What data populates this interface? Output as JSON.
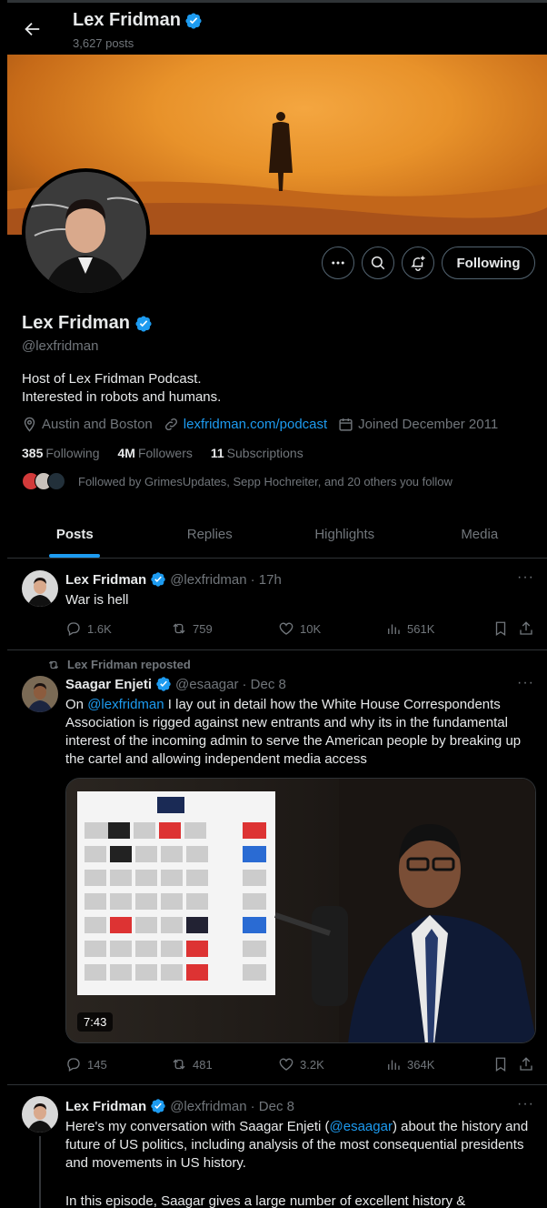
{
  "header": {
    "name": "Lex Fridman",
    "posts_count": "3,627 posts"
  },
  "profile": {
    "name": "Lex Fridman",
    "handle": "@lexfridman",
    "bio_line1": "Host of Lex Fridman Podcast.",
    "bio_line2": "Interested in robots and humans.",
    "location": "Austin and Boston",
    "website": "lexfridman.com/podcast",
    "joined": "Joined December 2011",
    "following_count": "385",
    "following_label": "Following",
    "followers_count": "4M",
    "followers_label": "Followers",
    "subs_count": "11",
    "subs_label": "Subscriptions",
    "followed_by": "Followed by GrimesUpdates, Sepp Hochreiter, and 20 others you follow",
    "follow_button": "Following"
  },
  "tabs": [
    "Posts",
    "Replies",
    "Highlights",
    "Media"
  ],
  "posts": [
    {
      "name": "Lex Fridman",
      "handle": "@lexfridman",
      "time": "· 17h",
      "text": "War is hell",
      "replies": "1.6K",
      "reposts": "759",
      "likes": "10K",
      "views": "561K"
    },
    {
      "repost_label": "Lex Fridman reposted",
      "name": "Saagar Enjeti",
      "handle": "@esaagar",
      "time": "· Dec 8",
      "mention": "@lexfridman",
      "text_prefix": "On ",
      "text_rest": " I lay out in detail how the White House Correspondents Association is rigged against new entrants and why its in the fundamental interest of the incoming admin to serve the American people by breaking up the cartel and allowing independent media access",
      "video_duration": "7:43",
      "replies": "145",
      "reposts": "481",
      "likes": "3.2K",
      "views": "364K"
    },
    {
      "name": "Lex Fridman",
      "handle": "@lexfridman",
      "time": "· Dec 8",
      "text_a": "Here's my conversation with Saagar Enjeti (",
      "mention": "@esaagar",
      "text_b": ") about the history and future of US politics, including analysis of the most consequential presidents and movements in US history.",
      "text_c": "In this episode, Saagar gives a large number of excellent history &"
    }
  ],
  "colors": {
    "accent": "#1d9bf0",
    "muted": "#71767b",
    "text": "#e7e9ea",
    "border": "#2f3336"
  }
}
